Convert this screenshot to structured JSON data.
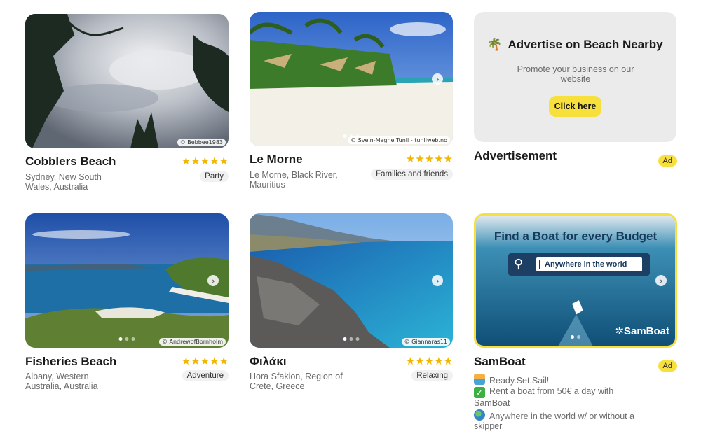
{
  "cards": [
    {
      "title": "Cobblers Beach",
      "location": "Sydney, New South Wales, Australia",
      "tag": "Party",
      "credit": "© Bebbee1983",
      "rating": 5
    },
    {
      "title": "Le Morne",
      "location": "Le Morne, Black River, Mauritius",
      "tag": "Families and friends",
      "credit": "© Svein-Magne Tunli - tunliweb.no",
      "rating": 5
    },
    {
      "title": "Fisheries Beach",
      "location": "Albany, Western Australia, Australia",
      "tag": "Adventure",
      "credit": "© AndrewofBornholm",
      "rating": 5
    },
    {
      "title": "Φιλάκι",
      "location": "Hora Sfakion, Region of Crete, Greece",
      "tag": "Relaxing",
      "credit": "© Giannaras11",
      "rating": 5
    }
  ],
  "advertise": {
    "icon": "palm-tree-icon",
    "heading": "Advertise on Beach Nearby",
    "subtext": "Promote your business on our website",
    "button": "Click here",
    "title": "Advertisement",
    "badge": "Ad"
  },
  "samboat": {
    "banner_heading": "Find a Boat for every Budget",
    "search_text": "Anywhere in the world",
    "logo": "SamBoat",
    "title": "SamBoat",
    "badge": "Ad",
    "lines": [
      {
        "icon": "sailboat-icon",
        "text": "Ready.Set.Sail!"
      },
      {
        "icon": "check-icon",
        "text": "Rent a boat from 50€ a day with SamBoat"
      },
      {
        "icon": "globe-icon",
        "text": "Anywhere in the world w/ or without a skipper"
      }
    ]
  },
  "colors": {
    "accent": "#f7e03c",
    "star": "#f2b600",
    "muted": "#6b6b6b"
  }
}
